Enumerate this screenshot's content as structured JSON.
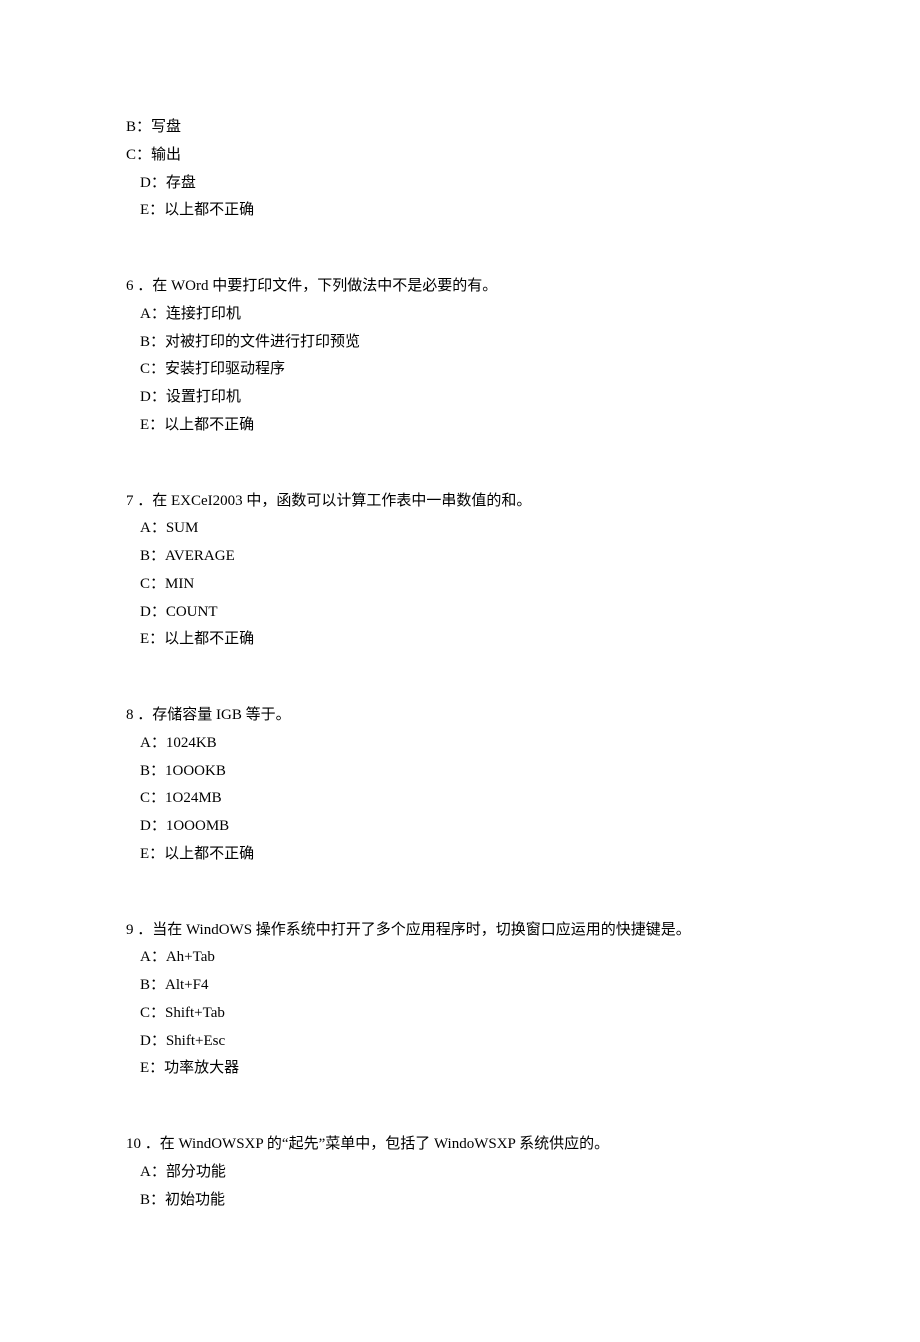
{
  "blocks": [
    {
      "lead": [
        "B：写盘",
        "C：输出"
      ],
      "options": [
        "D：存盘",
        "E：以上都不正确"
      ]
    },
    {
      "question": "6 ．在 WOrd 中要打印文件，下列做法中不是必要的有。",
      "options": [
        "A：连接打印机",
        "B：对被打印的文件进行打印预览",
        "C：安装打印驱动程序",
        "D：设置打印机",
        "E：以上都不正确"
      ]
    },
    {
      "question": "7 ．在 EXCeI2003 中，函数可以计算工作表中一串数值的和。",
      "options": [
        "A：SUM",
        "B：AVERAGE",
        "C：MIN",
        "D：COUNT",
        "E：以上都不正确"
      ]
    },
    {
      "question": "8 ．存储容量 IGB 等于。",
      "options": [
        "A：1024KB",
        "B：1OOOKB",
        "C：1O24MB",
        "D：1OOOMB",
        "E：以上都不正确"
      ]
    },
    {
      "question": "9 ．当在 WindOWS 操作系统中打开了多个应用程序时，切换窗口应运用的快捷键是。",
      "options": [
        "A：Ah+Tab",
        "B：Alt+F4",
        "C：Shift+Tab",
        "D：Shift+Esc",
        "E：功率放大器"
      ]
    },
    {
      "question": "10 ．在 WindOWSXP 的“起先”菜单中，包括了 WindoWSXP 系统供应的。",
      "options": [
        "A：部分功能",
        "B：初始功能"
      ]
    }
  ]
}
